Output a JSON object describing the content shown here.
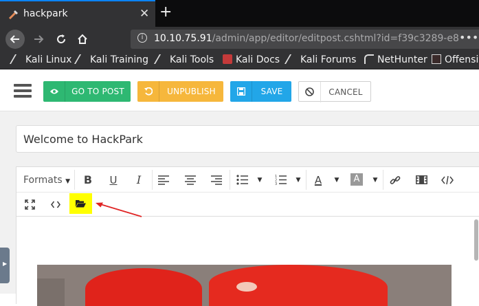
{
  "browser": {
    "tab_title": "hackpark",
    "tab_close": "✕",
    "new_tab": "+",
    "url_host": "10.10.75.91",
    "url_path": "/admin/app/editor/editpost.cshtml?id=f39c3289-e8",
    "more_menu": "•••",
    "bookmarks": [
      "Kali Linux",
      "Kali Training",
      "Kali Tools",
      "Kali Docs",
      "Kali Forums",
      "NetHunter",
      "Offensiv"
    ]
  },
  "toolbar": {
    "goto_label": "GO TO POST",
    "unpublish_label": "UNPUBLISH",
    "save_label": "SAVE",
    "cancel_label": "CANCEL"
  },
  "post": {
    "title": "Welcome to HackPark"
  },
  "editor": {
    "formats_label": "Formats",
    "icons": [
      "bold-icon",
      "underline-icon",
      "italic-icon",
      "align-left-icon",
      "align-center-icon",
      "align-right-icon",
      "bullet-list-icon",
      "numbered-list-icon",
      "text-color-icon",
      "background-color-icon",
      "link-icon",
      "media-icon",
      "code-icon",
      "fullscreen-icon",
      "source-code-icon",
      "file-manager-icon"
    ]
  },
  "colors": {
    "goto": "#2eb872",
    "unpublish": "#f6b73c",
    "save": "#22a6e8",
    "highlight": "#ffff00",
    "arrow": "#e02424"
  }
}
